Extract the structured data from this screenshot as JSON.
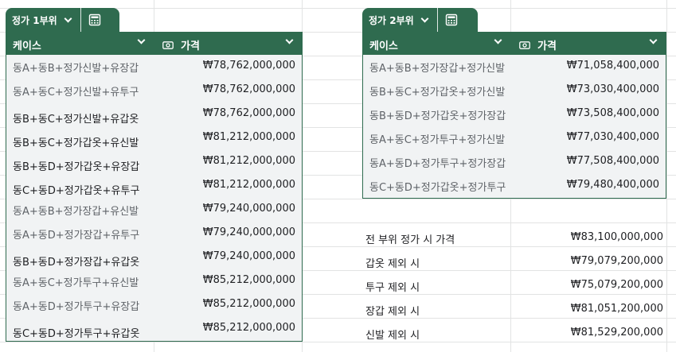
{
  "table1": {
    "tab_name": "정가 1부위",
    "header_case": "케이스",
    "header_price": "가격",
    "rows": [
      {
        "case": "동A+동B+정가신발+유장갑",
        "price": "₩78,762,000,000"
      },
      {
        "case": "동A+동C+정가신발+유투구",
        "price": "₩78,762,000,000"
      },
      {
        "case": "동B+동C+정가신발+유갑옷",
        "price": "₩78,762,000,000"
      },
      {
        "case": "동B+동C+정가갑옷+유신발",
        "price": "₩81,212,000,000"
      },
      {
        "case": "동B+동D+정가갑옷+유장갑",
        "price": "₩81,212,000,000"
      },
      {
        "case": "동C+동D+정가갑옷+유투구",
        "price": "₩81,212,000,000"
      },
      {
        "case": "동A+동B+정가장갑+유신발",
        "price": "₩79,240,000,000"
      },
      {
        "case": "동A+동D+정가장갑+유투구",
        "price": "₩79,240,000,000"
      },
      {
        "case": "동B+동D+정가장갑+유갑옷",
        "price": "₩79,240,000,000"
      },
      {
        "case": "동A+동C+정가투구+유신발",
        "price": "₩85,212,000,000"
      },
      {
        "case": "동A+동D+정가투구+유장갑",
        "price": "₩85,212,000,000"
      },
      {
        "case": "동C+동D+정가투구+유갑옷",
        "price": "₩85,212,000,000"
      }
    ]
  },
  "table2": {
    "tab_name": "정가 2부위",
    "header_case": "케이스",
    "header_price": "가격",
    "rows": [
      {
        "case": "동A+동B+정가장갑+정가신발",
        "price": "₩71,058,400,000"
      },
      {
        "case": "동B+동C+정가갑옷+정가신발",
        "price": "₩73,030,400,000"
      },
      {
        "case": "동B+동D+정가갑옷+정가장갑",
        "price": "₩73,508,400,000"
      },
      {
        "case": "동A+동C+정가투구+정가신발",
        "price": "₩77,030,400,000"
      },
      {
        "case": "동A+동D+정가투구+정가장갑",
        "price": "₩77,508,400,000"
      },
      {
        "case": "동C+동D+정가갑옷+정가투구",
        "price": "₩79,480,400,000"
      }
    ]
  },
  "summary": [
    {
      "label": "전 부위 정가 시 가격",
      "value": "₩83,100,000,000"
    },
    {
      "label": "갑옷 제외 시",
      "value": "₩79,079,200,000"
    },
    {
      "label": "투구 제외 시",
      "value": "₩75,079,200,000"
    },
    {
      "label": "장갑 제외 시",
      "value": "₩81,051,200,000"
    },
    {
      "label": "신발 제외 시",
      "value": "₩81,529,200,000"
    }
  ],
  "icons": {
    "calculator": "calculator-icon",
    "dropdown": "chevron-down-icon",
    "price_type": "currency-note-icon"
  },
  "colors": {
    "header_green": "#2f6b4f",
    "table_fill": "#f1f3f4",
    "grid": "#e2e3e3"
  }
}
